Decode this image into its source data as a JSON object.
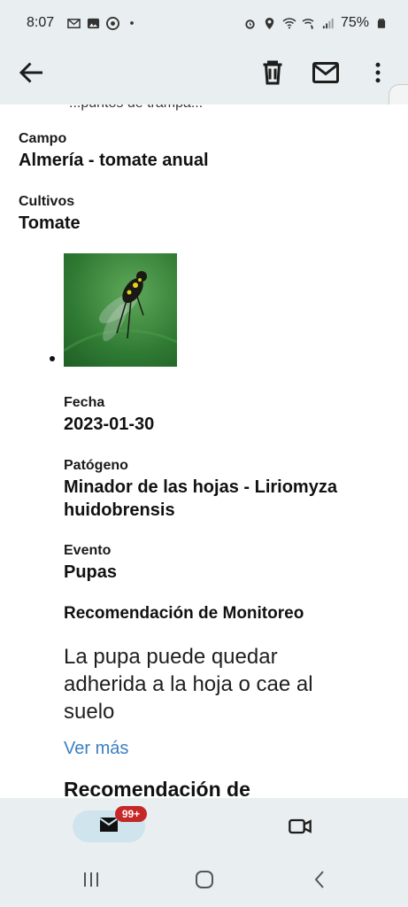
{
  "status_bar": {
    "time": "8:07",
    "battery": "75%",
    "left_icons": [
      "gmail-icon",
      "photo-icon",
      "chrome-icon",
      "dot-icon"
    ],
    "right_icons": [
      "alarm-icon",
      "location-icon",
      "wifi-icon",
      "wifi-call-icon",
      "signal-icon",
      "battery-icon"
    ]
  },
  "app_bar": {
    "icons": [
      "back-arrow-icon",
      "trash-icon",
      "mail-icon",
      "more-vert-icon"
    ]
  },
  "content": {
    "cut_text": "...puntos de trampa...",
    "campo_label": "Campo",
    "campo_value": "Almería - tomate anual",
    "cultivos_label": "Cultivos",
    "cultivos_value": "Tomate",
    "image_alt": "insect-photo",
    "fecha_label": "Fecha",
    "fecha_value": "2023-01-30",
    "patogeno_label": "Patógeno",
    "patogeno_value_1": "Minador de las hojas - Liriomyza",
    "patogeno_value_2": "huidobrensis",
    "evento_label": "Evento",
    "evento_value": "Pupas",
    "recomendacion_label": "Recomendación de Monitoreo",
    "recomendacion_text": "La pupa puede quedar adherida a la hoja o cae al suelo",
    "ver_mas": "Ver más",
    "next_heading": "Recomendación de"
  },
  "bottom_nav": {
    "badge": "99+",
    "icons": [
      "mail-icon",
      "video-icon"
    ]
  },
  "system_nav": {
    "icons": [
      "recents-icon",
      "home-icon",
      "back-icon"
    ]
  },
  "colors": {
    "bar_bg": "#e9eff0",
    "link": "#3a7fc1",
    "badge": "#c62828",
    "pill": "#cfe4ec"
  }
}
